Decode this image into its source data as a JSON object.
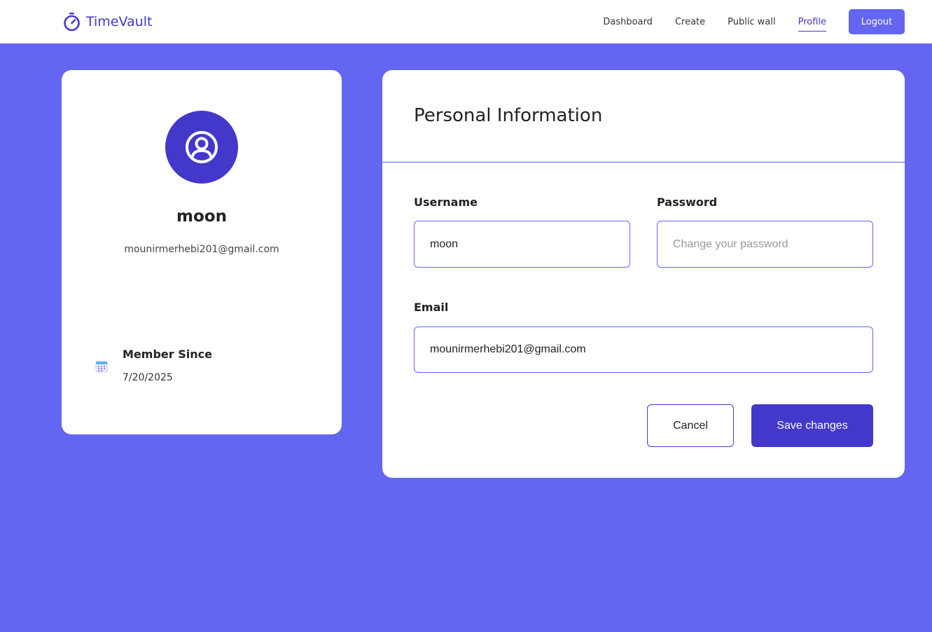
{
  "header": {
    "brand": "TimeVault",
    "brand_icon": "stopwatch-icon",
    "nav": [
      {
        "label": "Dashboard",
        "active": false
      },
      {
        "label": "Create",
        "active": false
      },
      {
        "label": "Public wall",
        "active": false
      },
      {
        "label": "Profile",
        "active": true
      }
    ],
    "logout_label": "Logout"
  },
  "profile": {
    "avatar_icon": "user-circle-icon",
    "name": "moon",
    "email": "mounirmerhebi201@gmail.com",
    "member_since_icon": "calendar-icon",
    "member_since_label": "Member Since",
    "member_since_date": "7/20/2025"
  },
  "info": {
    "title": "Personal Information",
    "username_label": "Username",
    "username_value": "moon",
    "password_label": "Password",
    "password_value": "",
    "password_placeholder": "Change your password",
    "email_label": "Email",
    "email_value": "mounirmerhebi201@gmail.com",
    "cancel_label": "Cancel",
    "save_label": "Save changes"
  },
  "colors": {
    "background": "#6366f1",
    "accent": "#4338ca",
    "card": "#ffffff"
  }
}
